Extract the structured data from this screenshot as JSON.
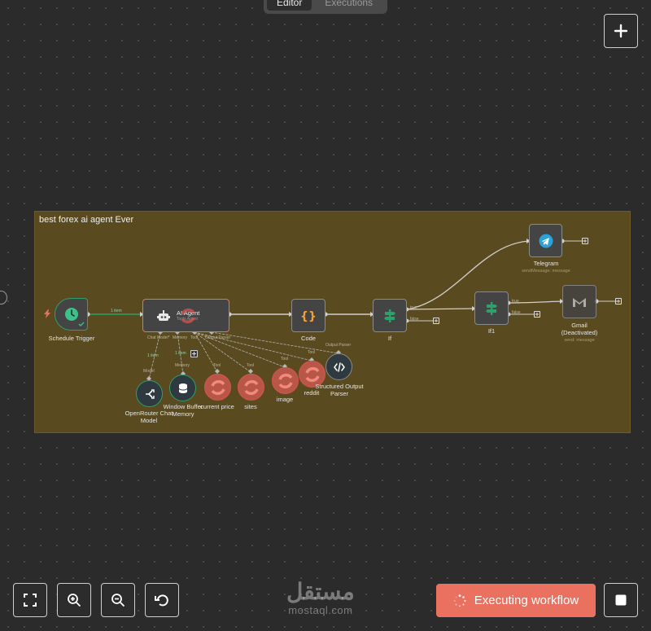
{
  "tabs": {
    "editor": "Editor",
    "executions": "Executions"
  },
  "sticky_note": {
    "title": "best forex ai agent Ever"
  },
  "nodes": {
    "schedule_trigger": {
      "label": "Schedule Trigger"
    },
    "ai_agent": {
      "label": "AI Agent",
      "subtitle": "Tools Agent"
    },
    "code": {
      "label": "Code"
    },
    "if": {
      "label": "If"
    },
    "if1": {
      "label": "If1"
    },
    "telegram": {
      "label": "Telegram",
      "subtitle": "sendMessage: message"
    },
    "gmail": {
      "label": "Gmail",
      "label2": "(Deactivated)",
      "subtitle": "send: message"
    },
    "openrouter": {
      "label": "OpenRouter Chat",
      "label2": "Model"
    },
    "window_buffer": {
      "label": "Window Buffer",
      "label2": "Memory"
    },
    "current_price": {
      "label": "current price"
    },
    "sites": {
      "label": "sites"
    },
    "image": {
      "label": "image"
    },
    "reddit": {
      "label": "reddit"
    },
    "structured_parser": {
      "label": "Structured Output",
      "label2": "Parser"
    }
  },
  "ports": {
    "chat_model": "Chat Model*",
    "memory": "Memory",
    "tool": "Tool",
    "output_parser": "Output Parser",
    "model": "Model",
    "true": "true",
    "false": "false"
  },
  "edge_labels": {
    "trigger_to_agent": "1 item",
    "agent_to_model": "1 item",
    "agent_to_memory": "1 item"
  },
  "controls": {
    "execute_label": "Executing workflow"
  },
  "watermark": {
    "arabic": "مستقل",
    "latin": "mostaql.com"
  },
  "colors": {
    "accent": "#ea7160",
    "sticky": "#5a4a1f",
    "telegram": "#2aa3db",
    "if_green": "#2ea06b",
    "code_orange": "#f4a235",
    "error_red": "#d9534f"
  }
}
